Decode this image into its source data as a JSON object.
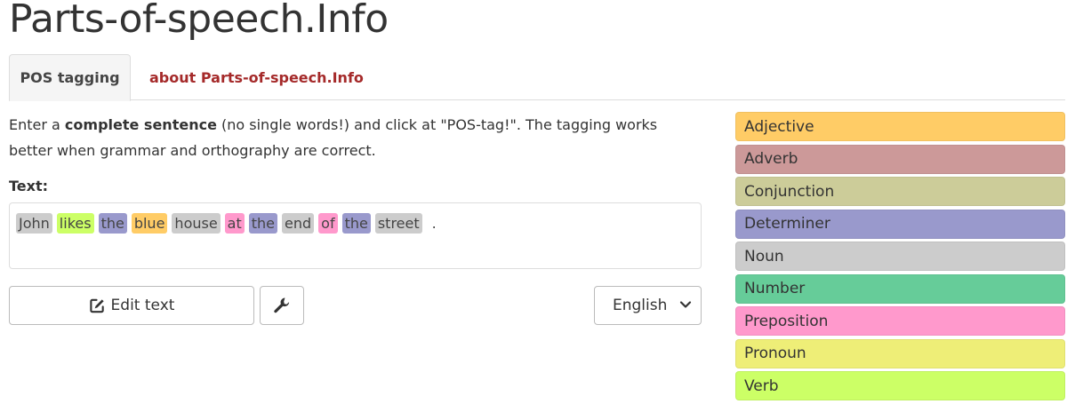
{
  "site": {
    "title": "Parts-of-speech.Info"
  },
  "tabs": [
    {
      "label": "POS tagging",
      "active": true
    },
    {
      "label": "about Parts-of-speech.Info",
      "active": false
    }
  ],
  "intro": {
    "prefix": "Enter a ",
    "bold": "complete sentence",
    "suffix": " (no single words!) and click at \"POS-tag!\". The tagging works better when grammar and orthography are correct."
  },
  "text_label": "Text:",
  "tagged_text": [
    {
      "word": "John",
      "tag": "Noun",
      "color": "#cccccc"
    },
    {
      "word": "likes",
      "tag": "Verb",
      "color": "#ccff66"
    },
    {
      "word": "the",
      "tag": "Determiner",
      "color": "#9999cc"
    },
    {
      "word": "blue",
      "tag": "Adjective",
      "color": "#ffcc66"
    },
    {
      "word": "house",
      "tag": "Noun",
      "color": "#cccccc"
    },
    {
      "word": "at",
      "tag": "Preposition",
      "color": "#ff99cc"
    },
    {
      "word": "the",
      "tag": "Determiner",
      "color": "#9999cc"
    },
    {
      "word": "end",
      "tag": "Noun",
      "color": "#cccccc"
    },
    {
      "word": "of",
      "tag": "Preposition",
      "color": "#ff99cc"
    },
    {
      "word": "the",
      "tag": "Determiner",
      "color": "#9999cc"
    },
    {
      "word": "street",
      "tag": "Noun",
      "color": "#cccccc"
    },
    {
      "word": ".",
      "tag": "Punctuation",
      "color": "transparent"
    }
  ],
  "buttons": {
    "edit_label": "Edit text",
    "edit_icon": "edit-icon",
    "tool_icon": "wrench-icon"
  },
  "language": {
    "selected": "English",
    "icon": "chevron-down-icon"
  },
  "legend": [
    {
      "label": "Adjective",
      "color": "#ffcc66"
    },
    {
      "label": "Adverb",
      "color": "#cc9999"
    },
    {
      "label": "Conjunction",
      "color": "#cccc99"
    },
    {
      "label": "Determiner",
      "color": "#9999cc"
    },
    {
      "label": "Noun",
      "color": "#cccccc"
    },
    {
      "label": "Number",
      "color": "#66cc99"
    },
    {
      "label": "Preposition",
      "color": "#ff99cc"
    },
    {
      "label": "Pronoun",
      "color": "#eeee77"
    },
    {
      "label": "Verb",
      "color": "#ccff66"
    }
  ]
}
